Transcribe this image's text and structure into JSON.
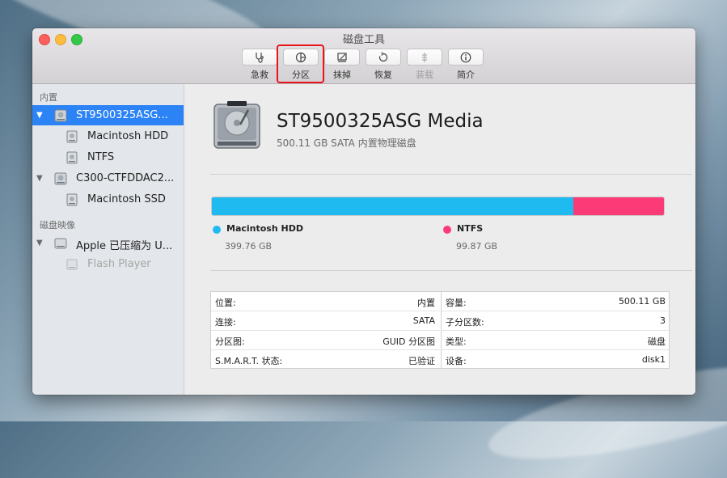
{
  "window": {
    "title": "磁盘工具"
  },
  "toolbar": {
    "buttons": [
      {
        "label": "急救",
        "icon": "stethoscope-icon",
        "enabled": true
      },
      {
        "label": "分区",
        "icon": "partition-pie-icon",
        "enabled": true,
        "highlighted": true
      },
      {
        "label": "抹掉",
        "icon": "erase-icon",
        "enabled": true
      },
      {
        "label": "恢复",
        "icon": "restore-icon",
        "enabled": true
      },
      {
        "label": "装载",
        "icon": "mount-icon",
        "enabled": false
      },
      {
        "label": "简介",
        "icon": "info-icon",
        "enabled": true
      }
    ]
  },
  "sidebar": {
    "internal_header": "内置",
    "internal": [
      {
        "label": "ST9500325ASG...",
        "type": "disk",
        "selected": true
      },
      {
        "label": "Macintosh HDD",
        "type": "volume"
      },
      {
        "label": "NTFS",
        "type": "volume"
      },
      {
        "label": "C300-CTFDDAC2...",
        "type": "disk"
      },
      {
        "label": "Macintosh SSD",
        "type": "volume"
      }
    ],
    "images_header": "磁盘映像",
    "images": [
      {
        "label": "Apple 已压缩为 U...",
        "type": "disk"
      },
      {
        "label": "Flash Player",
        "type": "volume",
        "dim": true
      }
    ]
  },
  "detail": {
    "name": "ST9500325ASG Media",
    "subtitle": "500.11 GB SATA 内置物理磁盘",
    "partitions": [
      {
        "name": "Macintosh HDD",
        "size": "399.76 GB",
        "color": "#1fbaf0",
        "fraction": 0.7994
      },
      {
        "name": "NTFS",
        "size": "99.87 GB",
        "color": "#fb3a77",
        "fraction": 0.1997
      }
    ],
    "info_left": [
      {
        "key": "位置:",
        "value": "内置"
      },
      {
        "key": "连接:",
        "value": "SATA"
      },
      {
        "key": "分区图:",
        "value": "GUID 分区图"
      },
      {
        "key": "S.M.A.R.T. 状态:",
        "value": "已验证"
      }
    ],
    "info_right": [
      {
        "key": "容量:",
        "value": "500.11 GB"
      },
      {
        "key": "子分区数:",
        "value": "3"
      },
      {
        "key": "类型:",
        "value": "磁盘"
      },
      {
        "key": "设备:",
        "value": "disk1"
      }
    ]
  }
}
